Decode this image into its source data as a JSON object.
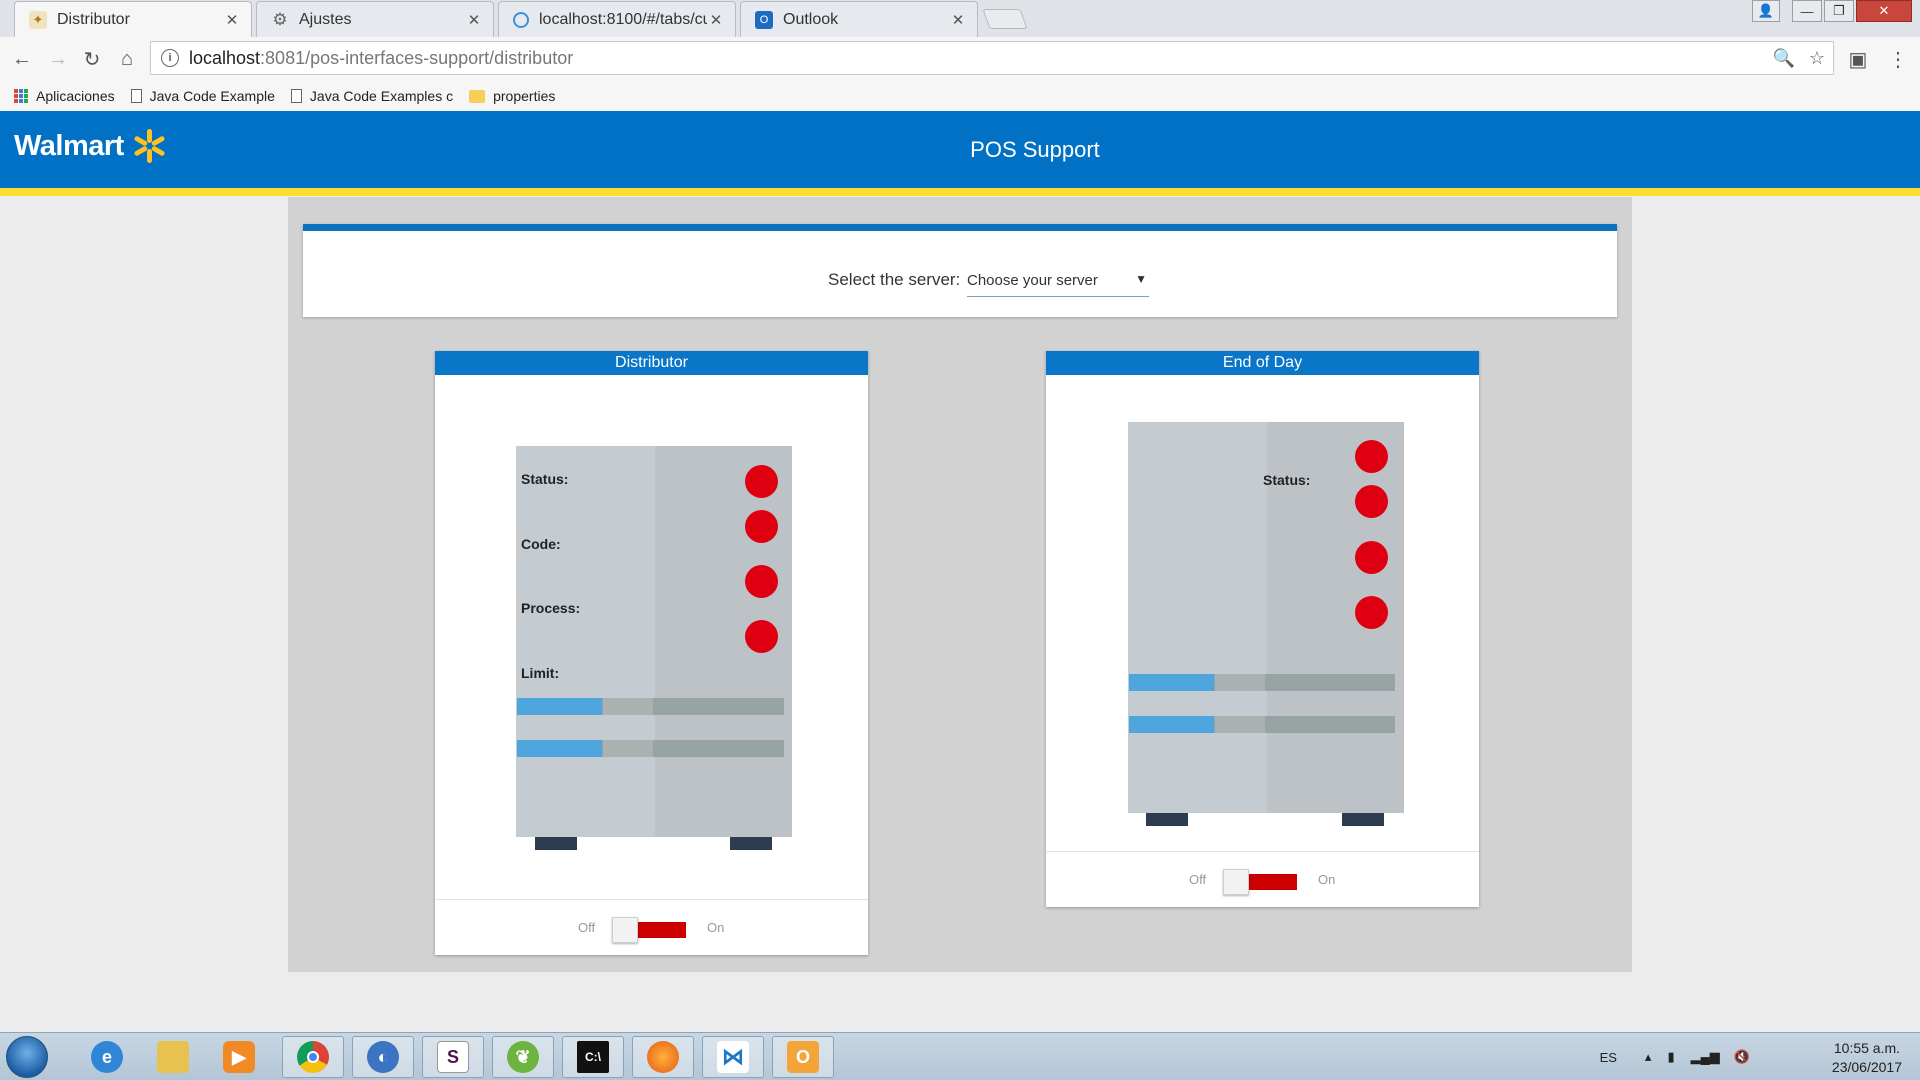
{
  "browser": {
    "tabs": [
      {
        "title": "Distributor",
        "icon": "walmart-favicon"
      },
      {
        "title": "Ajustes",
        "icon": "gear-icon"
      },
      {
        "title": "localhost:8100/#/tabs/cu",
        "icon": "ionic-favicon"
      },
      {
        "title": "Outlook",
        "icon": "outlook-favicon"
      }
    ],
    "url_host": "localhost",
    "url_path": ":8081/pos-interfaces-support/distributor",
    "bookmarks": [
      "Aplicaciones",
      "Java Code Example",
      "Java Code Examples c",
      "properties"
    ]
  },
  "app": {
    "brand": "Walmart",
    "title": "POS Support",
    "colors": {
      "header": "#0071c5",
      "stripe": "#ffdd2f",
      "status_dot": "#de0010",
      "toggle_track": "#cc0000"
    }
  },
  "selector": {
    "label": "Select the server:",
    "placeholder": "Choose your server"
  },
  "cards": {
    "distributor": {
      "title": "Distributor",
      "labels": [
        "Status:",
        "Code:",
        "Process:",
        "Limit:"
      ],
      "toggle_off": "Off",
      "toggle_on": "On",
      "bar_fill": [
        0.32,
        0.32
      ]
    },
    "end_of_day": {
      "title": "End of Day",
      "labels": [
        "Status:"
      ],
      "toggle_off": "Off",
      "toggle_on": "On",
      "bar_fill": [
        0.32,
        0.32
      ]
    }
  },
  "taskbar": {
    "language": "ES",
    "time": "10:55 a.m.",
    "date": "23/06/2017"
  }
}
